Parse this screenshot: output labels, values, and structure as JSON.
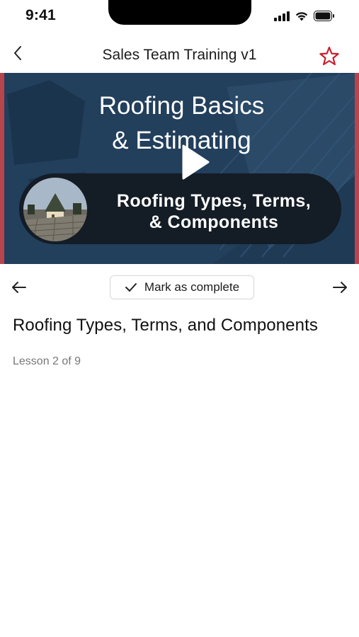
{
  "status_bar": {
    "time": "9:41",
    "icons": [
      "signal-icon",
      "wifi-icon",
      "battery-icon"
    ]
  },
  "header": {
    "title": "Sales Team Training v1",
    "back_icon": "chevron-left-icon",
    "favorite_icon": "star-outline-icon",
    "accent_color": "#c8202e"
  },
  "video": {
    "title_line1": "Roofing Basics",
    "title_line2": "& Estimating",
    "subtitle_line1": "Roofing Types, Terms,",
    "subtitle_line2": "& Components",
    "play_icon": "play-icon"
  },
  "lesson_nav": {
    "prev_icon": "arrow-left-icon",
    "next_icon": "arrow-right-icon",
    "mark_complete_label": "Mark as complete",
    "check_icon": "checkmark-icon"
  },
  "lesson": {
    "title": "Roofing Types, Terms, and Components",
    "progress_text": "Lesson 2 of 9"
  }
}
